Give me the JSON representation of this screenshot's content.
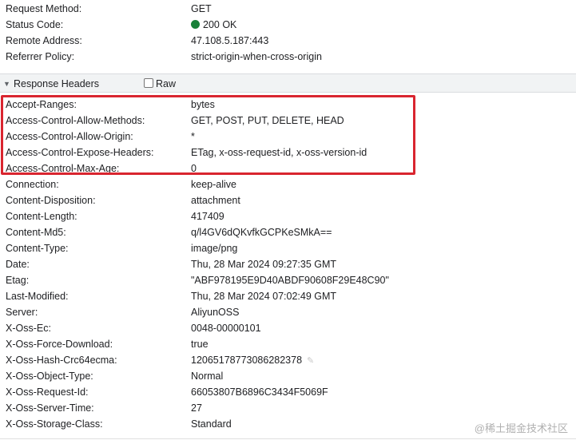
{
  "general": [
    {
      "key": "Request Method:",
      "value": "GET"
    },
    {
      "key": "Status Code:",
      "value": "200 OK",
      "status_color": "#188038"
    },
    {
      "key": "Remote Address:",
      "value": "47.108.5.187:443"
    },
    {
      "key": "Referrer Policy:",
      "value": "strict-origin-when-cross-origin"
    }
  ],
  "response_headers": {
    "title": "Response Headers",
    "raw_label": "Raw",
    "raw_checked": false,
    "highlight_color": "#d9252f",
    "items": [
      {
        "key": "Accept-Ranges:",
        "value": "bytes"
      },
      {
        "key": "Access-Control-Allow-Methods:",
        "value": "GET, POST, PUT, DELETE, HEAD"
      },
      {
        "key": "Access-Control-Allow-Origin:",
        "value": "*"
      },
      {
        "key": "Access-Control-Expose-Headers:",
        "value": "ETag, x-oss-request-id, x-oss-version-id"
      },
      {
        "key": "Access-Control-Max-Age:",
        "value": "0"
      },
      {
        "key": "Connection:",
        "value": "keep-alive"
      },
      {
        "key": "Content-Disposition:",
        "value": "attachment"
      },
      {
        "key": "Content-Length:",
        "value": "417409"
      },
      {
        "key": "Content-Md5:",
        "value": "q/l4GV6dQKvfkGCPKeSMkA=="
      },
      {
        "key": "Content-Type:",
        "value": "image/png"
      },
      {
        "key": "Date:",
        "value": "Thu, 28 Mar 2024 09:27:35 GMT"
      },
      {
        "key": "Etag:",
        "value": "\"ABF978195E9D40ABDF90608F29E48C90\""
      },
      {
        "key": "Last-Modified:",
        "value": "Thu, 28 Mar 2024 07:02:49 GMT"
      },
      {
        "key": "Server:",
        "value": "AliyunOSS"
      },
      {
        "key": "X-Oss-Ec:",
        "value": "0048-00000101"
      },
      {
        "key": "X-Oss-Force-Download:",
        "value": "true"
      },
      {
        "key": "X-Oss-Hash-Crc64ecma:",
        "value": "12065178773086282378"
      },
      {
        "key": "X-Oss-Object-Type:",
        "value": "Normal"
      },
      {
        "key": "X-Oss-Request-Id:",
        "value": "66053807B6896C3434F5069F"
      },
      {
        "key": "X-Oss-Server-Time:",
        "value": "27"
      },
      {
        "key": "X-Oss-Storage-Class:",
        "value": "Standard"
      }
    ]
  },
  "watermark": "@稀土掘金技术社区"
}
